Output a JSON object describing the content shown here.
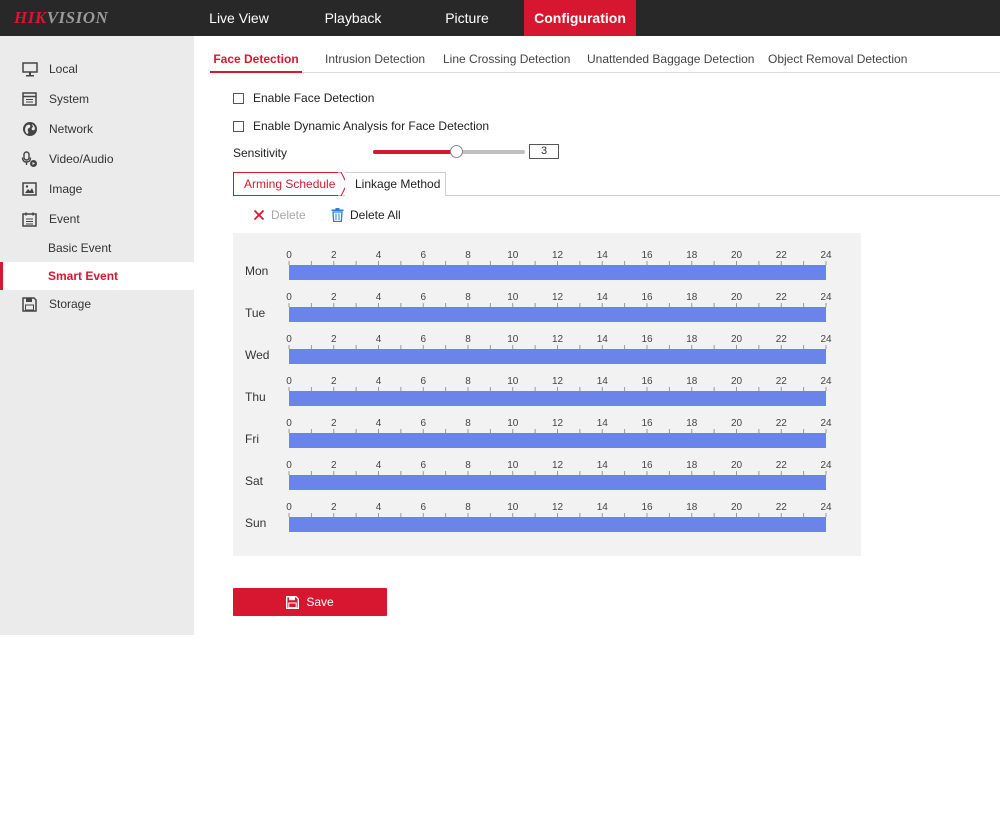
{
  "brand": {
    "logo_hi": "HIK",
    "logo_rest": "VISION"
  },
  "nav": {
    "items": [
      {
        "label": "Live View",
        "active": false
      },
      {
        "label": "Playback",
        "active": false
      },
      {
        "label": "Picture",
        "active": false
      },
      {
        "label": "Configuration",
        "active": true
      }
    ]
  },
  "sidebar": {
    "items": [
      {
        "label": "Local",
        "icon": "monitor-icon"
      },
      {
        "label": "System",
        "icon": "system-window-icon"
      },
      {
        "label": "Network",
        "icon": "globe-icon"
      },
      {
        "label": "Video/Audio",
        "icon": "microphone-icon"
      },
      {
        "label": "Image",
        "icon": "image-icon"
      },
      {
        "label": "Event",
        "icon": "calendar-icon"
      },
      {
        "label": "Storage",
        "icon": "floppy-disk-icon"
      }
    ],
    "subitems": [
      {
        "label": "Basic Event",
        "active": false
      },
      {
        "label": "Smart Event",
        "active": true
      }
    ]
  },
  "tabs": [
    {
      "label": "Face Detection",
      "active": true
    },
    {
      "label": "Intrusion Detection",
      "active": false
    },
    {
      "label": "Line Crossing Detection",
      "active": false
    },
    {
      "label": "Unattended Baggage Detection",
      "active": false
    },
    {
      "label": "Object Removal Detection",
      "active": false
    }
  ],
  "options": {
    "enable_face_label": "Enable Face Detection",
    "enable_face_checked": false,
    "enable_dynamic_label": "Enable Dynamic Analysis for Face Detection",
    "enable_dynamic_checked": false
  },
  "sensitivity": {
    "label": "Sensitivity",
    "value": "3",
    "min": 0,
    "max": 5
  },
  "subtabs": {
    "arming": "Arming Schedule",
    "linkage": "Linkage Method"
  },
  "actions": {
    "delete": "Delete",
    "delete_all": "Delete All",
    "save": "Save"
  },
  "schedule": {
    "days": [
      "Mon",
      "Tue",
      "Wed",
      "Thu",
      "Fri",
      "Sat",
      "Sun"
    ],
    "hour_labels": [
      "0",
      "2",
      "4",
      "6",
      "8",
      "10",
      "12",
      "14",
      "16",
      "18",
      "20",
      "22",
      "24"
    ],
    "armed_start_hour": 0,
    "armed_end_hour": 24,
    "bar_color": "#6a84ea"
  },
  "colors": {
    "accent": "#d7172f",
    "topbar": "#282828",
    "sidebar": "#ebebeb"
  }
}
